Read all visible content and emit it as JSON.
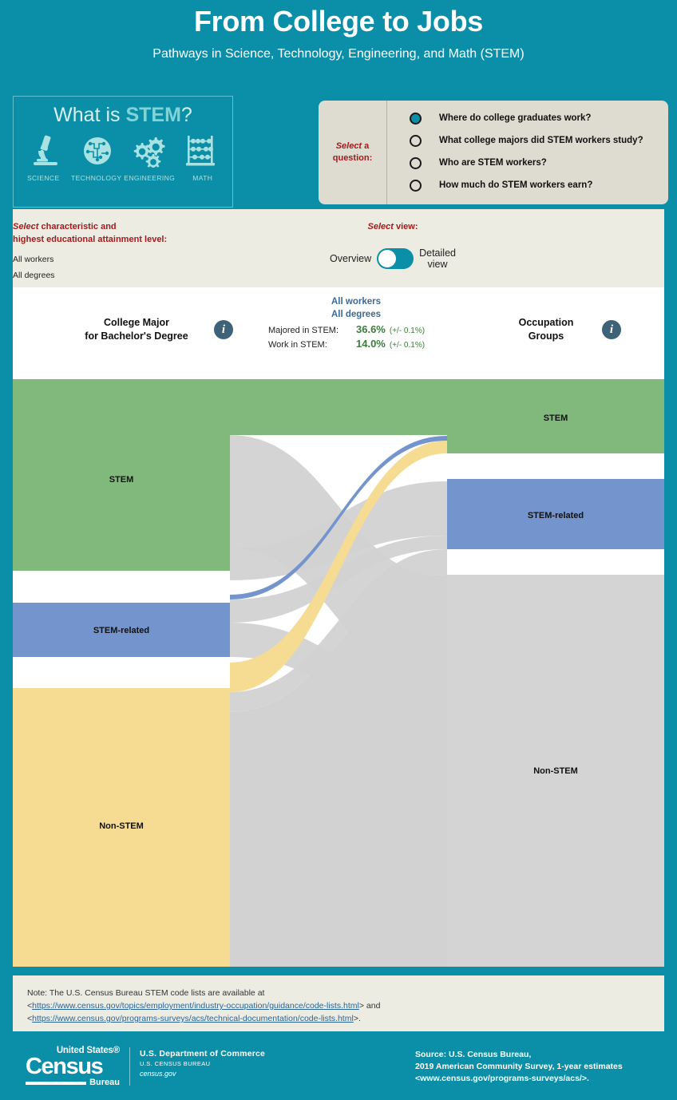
{
  "header": {
    "title": "From College to Jobs",
    "subtitle": "Pathways in Science, Technology, Engineering, and Math (STEM)"
  },
  "stem_box": {
    "title_plain": "What is ",
    "title_bold": "STEM",
    "title_end": "?",
    "labels": [
      "SCIENCE",
      "TECHNOLOGY",
      "ENGINEERING",
      "MATH"
    ],
    "icons": [
      "microscope-icon",
      "circuit-globe-icon",
      "gears-icon",
      "abacus-icon"
    ]
  },
  "question_panel": {
    "select_label_em": "Select",
    "select_label_rest": " a",
    "select_label_line2": "question:",
    "options": [
      {
        "label": "Where do college graduates work?",
        "selected": true
      },
      {
        "label": "What college majors did STEM workers study?",
        "selected": false
      },
      {
        "label": "Who are STEM workers?",
        "selected": false
      },
      {
        "label": "How much do STEM workers earn?",
        "selected": false
      }
    ]
  },
  "controls": {
    "select_em": "Select",
    "select_rest": " characteristic and",
    "select_line2": "highest educational attainment level:",
    "value_characteristic": "All workers",
    "value_degree": "All degrees",
    "view_em": "Select",
    "view_rest": " view:",
    "toggle_left": "Overview",
    "toggle_right_line1": "Detailed",
    "toggle_right_line2": "view",
    "toggle_state": "overview"
  },
  "chart_header": {
    "left_line1": "College Major",
    "left_line2": "for Bachelor's Degree",
    "left_info_icon": "info-icon",
    "right_line1": "Occupation",
    "right_line2": "Groups",
    "right_info_icon": "info-icon",
    "scope_line1": "All workers",
    "scope_line2": "All degrees",
    "stats": [
      {
        "label": "Majored in STEM:",
        "value": "36.6%",
        "moe": "(+/- 0.1%)"
      },
      {
        "label": "Work in STEM:",
        "value": "14.0%",
        "moe": "(+/- 0.1%)"
      }
    ]
  },
  "chart_data": {
    "type": "sankey",
    "title": "From College to Jobs: College Major for Bachelor's Degree to Occupation Groups",
    "left_axis_title": "College Major for Bachelor's Degree",
    "right_axis_title": "Occupation Groups",
    "colors": {
      "stem": "#81b97c",
      "stem_related": "#7394cc",
      "non_stem": "#f5dc92",
      "gray_flow": "#d2d2d2",
      "occupation_non_stem": "#d4d4d4"
    },
    "nodes_left": [
      {
        "name": "STEM",
        "value_pct": 36.6,
        "color": "#81b97c"
      },
      {
        "name": "STEM-related",
        "value_pct": 10.5,
        "color": "#7394cc"
      },
      {
        "name": "Non-STEM",
        "value_pct": 52.9,
        "color": "#f5dc92"
      }
    ],
    "nodes_right": [
      {
        "name": "STEM",
        "value_pct": 14.0,
        "color": "#81b97c"
      },
      {
        "name": "STEM-related",
        "value_pct": 13.6,
        "color": "#7394cc"
      },
      {
        "name": "Non-STEM",
        "value_pct": 72.4,
        "color": "#d4d4d4"
      }
    ],
    "links": [
      {
        "source": "STEM",
        "target": "STEM",
        "value_pct": 10.3,
        "color": "#81b97c"
      },
      {
        "source": "STEM",
        "target": "STEM-related",
        "value_pct": 5.0,
        "color": "#d2d2d2"
      },
      {
        "source": "STEM",
        "target": "Non-STEM",
        "value_pct": 21.3,
        "color": "#d2d2d2"
      },
      {
        "source": "STEM-related",
        "target": "STEM",
        "value_pct": 0.6,
        "color": "#7394cc"
      },
      {
        "source": "STEM-related",
        "target": "STEM-related",
        "value_pct": 3.4,
        "color": "#d2d2d2"
      },
      {
        "source": "STEM-related",
        "target": "Non-STEM",
        "value_pct": 6.5,
        "color": "#d2d2d2"
      },
      {
        "source": "Non-STEM",
        "target": "STEM",
        "value_pct": 3.1,
        "color": "#f5dc92"
      },
      {
        "source": "Non-STEM",
        "target": "STEM-related",
        "value_pct": 5.2,
        "color": "#d2d2d2"
      },
      {
        "source": "Non-STEM",
        "target": "Non-STEM",
        "value_pct": 44.6,
        "color": "#d2d2d2"
      }
    ],
    "legend": [],
    "grid": false
  },
  "note": {
    "line1": "Note: The U.S. Census Bureau STEM code lists are available at",
    "open1": "<",
    "link1": "https://www.census.gov/topics/employment/industry-occupation/guidance/code-lists.html",
    "close1": "> and",
    "open2": "<",
    "link2": "https://www.census.gov/programs-surveys/acs/technical-documentation/code-lists.html",
    "close2": ">."
  },
  "footer": {
    "logo_us": "United States®",
    "logo_census": "Census",
    "logo_bureau": "Bureau",
    "dept_line1": "U.S. Department of Commerce",
    "dept_line2": "U.S. CENSUS BUREAU",
    "dept_line3": "census.gov",
    "source_line1": "Source:  U.S. Census Bureau,",
    "source_line2": "2019 American Community Survey, 1-year estimates",
    "source_line3": "<www.census.gov/programs-surveys/acs/>."
  }
}
